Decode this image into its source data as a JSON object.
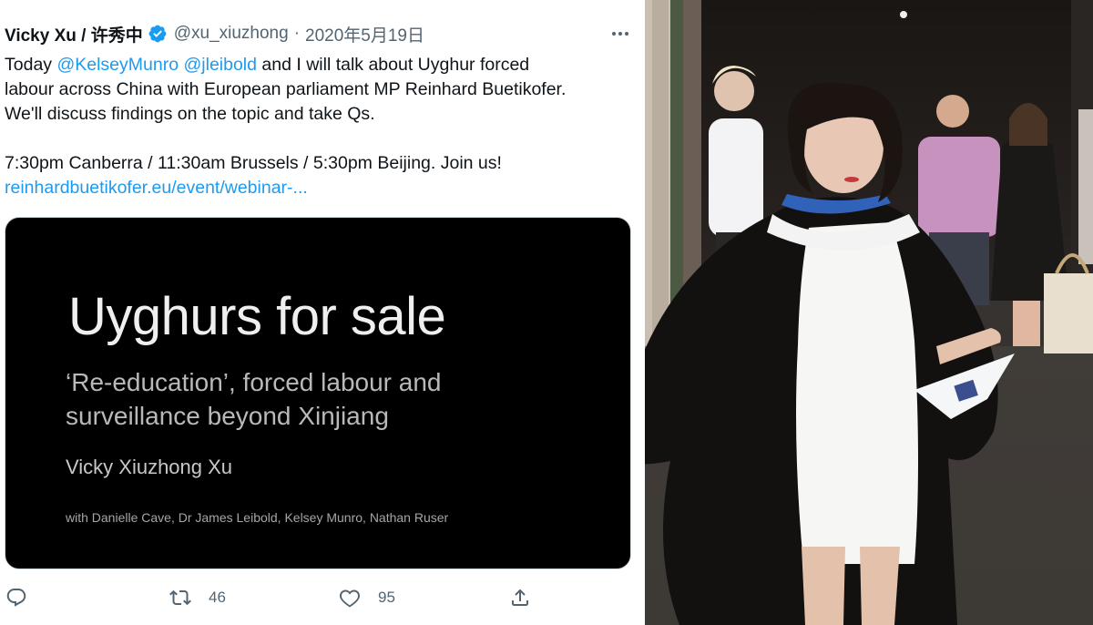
{
  "tweet": {
    "display_name": "Vicky Xu / 许秀中",
    "handle": "@xu_xiuzhong",
    "separator": "·",
    "date": "2020年5月19日",
    "body": {
      "line1_start": "Today ",
      "mention1": "@KelseyMunro",
      "space": " ",
      "mention2": "@jleibold",
      "line1_end": " and I will talk about Uyghur forced",
      "line2": "labour across China with European parliament MP Reinhard Buetikofer.",
      "line3": "We'll discuss findings on the topic and take Qs.",
      "line4": "7:30pm Canberra / 11:30am Brussels / 5:30pm Beijing. Join us!",
      "link": "reinhardbuetikofer.eu/event/webinar-..."
    },
    "card": {
      "title": "Uyghurs for sale",
      "subtitle_line1": "‘Re-education’, forced labour and",
      "subtitle_line2": "surveillance beyond Xinjiang",
      "author": "Vicky Xiuzhong Xu",
      "with_line": "with Danielle Cave, Dr James Leibold, Kelsey Munro, Nathan Ruser"
    },
    "actions": {
      "reply_icon": "reply-icon",
      "retweet_icon": "retweet-icon",
      "retweet_count": "46",
      "like_icon": "heart-icon",
      "like_count": "95",
      "share_icon": "share-icon"
    }
  },
  "colors": {
    "accent": "#1d9bf0",
    "text": "#0f1419",
    "muted": "#536471",
    "card_bg": "#000000"
  }
}
